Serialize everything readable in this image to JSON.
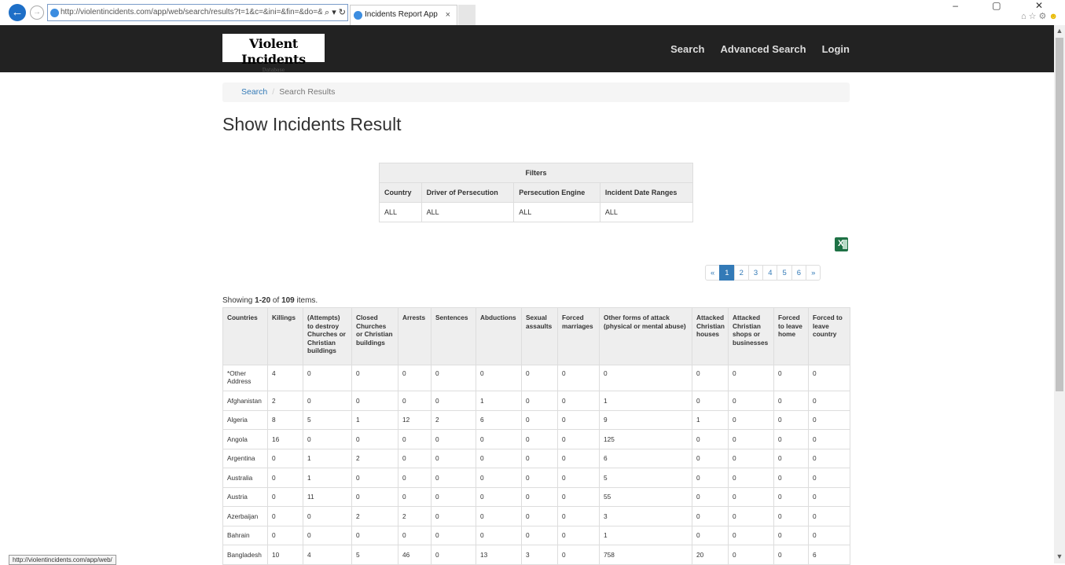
{
  "browser": {
    "url": "http://violentincidents.com/app/web/search/results?t=1&c=&ini=&fin=&do=&pe=&p",
    "tab_title": "Incidents Report App",
    "tab_close": "×",
    "address_tools": "⌕ ▾ ↻",
    "window_controls": "–  ▢  ✕",
    "status_url": "http://violentincidents.com/app/web/"
  },
  "brand": {
    "title": "Violent Incidents",
    "subtitle": "Database"
  },
  "nav": {
    "search": "Search",
    "advanced": "Advanced Search",
    "login": "Login"
  },
  "breadcrumb": {
    "link": "Search",
    "separator": "/",
    "current": "Search Results"
  },
  "page_title": "Show Incidents Result",
  "filters": {
    "title": "Filters",
    "headers": [
      "Country",
      "Driver of Persecution",
      "Persecution Engine",
      "Incident Date Ranges"
    ],
    "values": [
      "ALL",
      "ALL",
      "ALL",
      "ALL"
    ]
  },
  "pagination": [
    "«",
    "1",
    "2",
    "3",
    "4",
    "5",
    "6",
    "»"
  ],
  "summary": {
    "prefix": "Showing ",
    "range": "1-20",
    "of": " of ",
    "total": "109",
    "suffix": " items."
  },
  "table": {
    "headers": [
      "Countries",
      "Killings",
      "(Attempts) to destroy Churches or Christian buildings",
      "Closed Churches or Christian buildings",
      "Arrests",
      "Sentences",
      "Abductions",
      "Sexual assaults",
      "Forced marriages",
      "Other forms of attack (physical or mental abuse)",
      "Attacked Christian houses",
      "Attacked Christian shops or businesses",
      "Forced to leave home",
      "Forced to leave country"
    ],
    "rows": [
      [
        "*Other Address",
        "4",
        "0",
        "0",
        "0",
        "0",
        "0",
        "0",
        "0",
        "0",
        "0",
        "0",
        "0",
        "0"
      ],
      [
        "Afghanistan",
        "2",
        "0",
        "0",
        "0",
        "0",
        "1",
        "0",
        "0",
        "1",
        "0",
        "0",
        "0",
        "0"
      ],
      [
        "Algeria",
        "8",
        "5",
        "1",
        "12",
        "2",
        "6",
        "0",
        "0",
        "9",
        "1",
        "0",
        "0",
        "0"
      ],
      [
        "Angola",
        "16",
        "0",
        "0",
        "0",
        "0",
        "0",
        "0",
        "0",
        "125",
        "0",
        "0",
        "0",
        "0"
      ],
      [
        "Argentina",
        "0",
        "1",
        "2",
        "0",
        "0",
        "0",
        "0",
        "0",
        "6",
        "0",
        "0",
        "0",
        "0"
      ],
      [
        "Australia",
        "0",
        "1",
        "0",
        "0",
        "0",
        "0",
        "0",
        "0",
        "5",
        "0",
        "0",
        "0",
        "0"
      ],
      [
        "Austria",
        "0",
        "11",
        "0",
        "0",
        "0",
        "0",
        "0",
        "0",
        "55",
        "0",
        "0",
        "0",
        "0"
      ],
      [
        "Azerbaijan",
        "0",
        "0",
        "2",
        "2",
        "0",
        "0",
        "0",
        "0",
        "3",
        "0",
        "0",
        "0",
        "0"
      ],
      [
        "Bahrain",
        "0",
        "0",
        "0",
        "0",
        "0",
        "0",
        "0",
        "0",
        "1",
        "0",
        "0",
        "0",
        "0"
      ],
      [
        "Bangladesh",
        "10",
        "4",
        "5",
        "46",
        "0",
        "13",
        "3",
        "0",
        "758",
        "20",
        "0",
        "0",
        "6"
      ]
    ]
  }
}
